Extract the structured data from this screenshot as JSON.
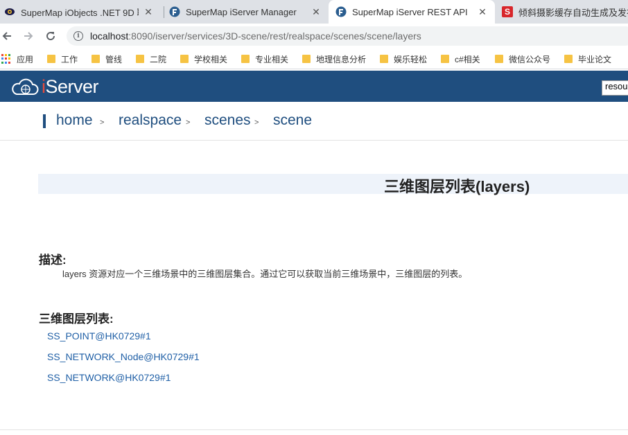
{
  "browser": {
    "tabs": [
      {
        "title": "SuperMap iObjects .NET 9D 联",
        "close": "✕"
      },
      {
        "title": "SuperMap iServer Manager",
        "close": "✕"
      },
      {
        "title": "SuperMap iServer REST API",
        "close": "✕"
      },
      {
        "title": "倾斜摄影缓存自动生成及发布",
        "favicon_letter": "S"
      }
    ],
    "url_host": "localhost",
    "url_path": ":8090/iserver/services/3D-scene/rest/realspace/scenes/scene/layers",
    "bookmarks": [
      {
        "label": "应用"
      },
      {
        "label": "工作"
      },
      {
        "label": "管线"
      },
      {
        "label": "二院"
      },
      {
        "label": "学校相关"
      },
      {
        "label": "专业相关"
      },
      {
        "label": "地理信息分析"
      },
      {
        "label": "娱乐轻松"
      },
      {
        "label": "c#相关"
      },
      {
        "label": "微信公众号"
      },
      {
        "label": "毕业论文"
      }
    ]
  },
  "site": {
    "brand_i": "i",
    "brand_rest": "Server",
    "search_value": "resou"
  },
  "breadcrumb": {
    "items": [
      "home",
      "realspace",
      "scenes",
      "scene"
    ],
    "separator": ">"
  },
  "content": {
    "title": "三维图层列表(layers)",
    "desc_heading": "描述:",
    "desc_text": "layers 资源对应一个三维场景中的三维图层集合。通过它可以获取当前三维场景中，三维图层的列表。",
    "list_heading": "三维图层列表:",
    "layers": [
      "SS_POINT@HK0729#1",
      "SS_NETWORK_Node@HK0729#1",
      "SS_NETWORK@HK0729#1"
    ]
  },
  "colors": {
    "header_bg": "#1f4e7f",
    "link": "#1f5fa6",
    "brand_i": "#e64b3c"
  }
}
